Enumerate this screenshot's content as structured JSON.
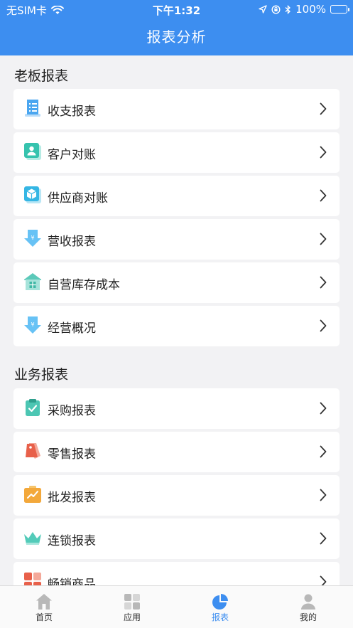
{
  "status_bar": {
    "carrier": "无SIM卡",
    "time": "下午1:32",
    "battery": "100%"
  },
  "header": {
    "title": "报表分析"
  },
  "sections": [
    {
      "title": "老板报表",
      "items": [
        {
          "label": "收支报表",
          "icon": "receipt-icon"
        },
        {
          "label": "客户对账",
          "icon": "customer-icon"
        },
        {
          "label": "供应商对账",
          "icon": "supplier-box-icon"
        },
        {
          "label": "营收报表",
          "icon": "yuan-down-arrow-icon"
        },
        {
          "label": "自营库存成本",
          "icon": "warehouse-icon"
        },
        {
          "label": "经营概况",
          "icon": "yuan-down-arrow-icon"
        }
      ]
    },
    {
      "title": "业务报表",
      "items": [
        {
          "label": "采购报表",
          "icon": "clipboard-check-icon"
        },
        {
          "label": "零售报表",
          "icon": "price-tag-icon"
        },
        {
          "label": "批发报表",
          "icon": "trend-board-icon"
        },
        {
          "label": "连锁报表",
          "icon": "crown-icon"
        },
        {
          "label": "畅销商品",
          "icon": "hot-goods-icon"
        }
      ]
    }
  ],
  "tabbar": [
    {
      "label": "首页",
      "icon": "home-icon",
      "active": false
    },
    {
      "label": "应用",
      "icon": "apps-grid-icon",
      "active": false
    },
    {
      "label": "报表",
      "icon": "pie-chart-icon",
      "active": true
    },
    {
      "label": "我的",
      "icon": "profile-icon",
      "active": false
    }
  ],
  "colors": {
    "header_blue": "#3d8ef0",
    "page_background": "#f2f2f4",
    "active_tab": "#3d8ef0"
  }
}
